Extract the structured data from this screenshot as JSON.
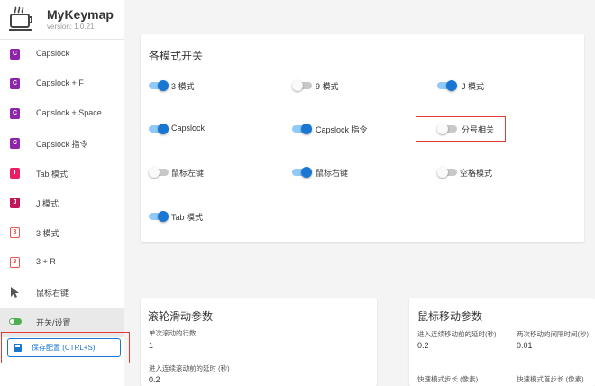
{
  "app": {
    "title": "MyKeymap",
    "version": "version: 1.0.21"
  },
  "sidebar": {
    "items": [
      {
        "badge": "C",
        "label": "Capslock",
        "color": "#8e24aa"
      },
      {
        "badge": "C",
        "label": "Capslock + F",
        "color": "#8e24aa"
      },
      {
        "badge": "C",
        "label": "Capslock + Space",
        "color": "#8e24aa"
      },
      {
        "badge": "C",
        "label": "Capslock 指令",
        "color": "#8e24aa"
      },
      {
        "badge": "T",
        "label": "Tab 模式",
        "color": "#e91e63"
      },
      {
        "badge": "J",
        "label": "J 模式",
        "color": "#c2185b"
      },
      {
        "badge": "3",
        "label": "3 模式",
        "color": "#ef5350"
      },
      {
        "badge": "3",
        "label": "3 + R",
        "color": "#ef5350"
      },
      {
        "label": "鼠标右键",
        "icon": "cursor-arrow-icon"
      },
      {
        "label": "开关/设置",
        "icon": "toggle-switch-icon"
      }
    ],
    "save_label": "保存配置 (CTRL+S)"
  },
  "modes": {
    "title": "各模式开关",
    "toggles": [
      {
        "label": "3 模式",
        "on": true
      },
      {
        "label": "9 模式",
        "on": false
      },
      {
        "label": "J 模式",
        "on": true
      },
      {
        "label": "Capslock",
        "on": true
      },
      {
        "label": "Capslock 指令",
        "on": true
      },
      {
        "label": "分号相关",
        "on": false
      },
      {
        "label": "鼠标左键",
        "on": false
      },
      {
        "label": "鼠标右键",
        "on": true
      },
      {
        "label": "空格模式",
        "on": false
      },
      {
        "label": "Tab 模式",
        "on": true
      }
    ]
  },
  "scroll": {
    "title": "滚轮滑动参数",
    "fields": [
      {
        "label": "单次滚动的行数",
        "value": "1"
      },
      {
        "label": "进入连续滚动前的延时 (秒)",
        "value": "0.2"
      }
    ]
  },
  "mouse": {
    "title": "鼠标移动参数",
    "fields": [
      {
        "label": "进入连续移动前的延时(秒)",
        "value": "0.2"
      },
      {
        "label": "两次移动的间隔时间(秒)",
        "value": "0.01"
      },
      {
        "label": "快速模式步长 (像素)",
        "value": ""
      },
      {
        "label": "快速模式首步长 (像素)",
        "value": ""
      }
    ]
  },
  "colors": {
    "accent": "#1976d2",
    "highlight": "#e53935",
    "track_on": "#90caf9"
  }
}
